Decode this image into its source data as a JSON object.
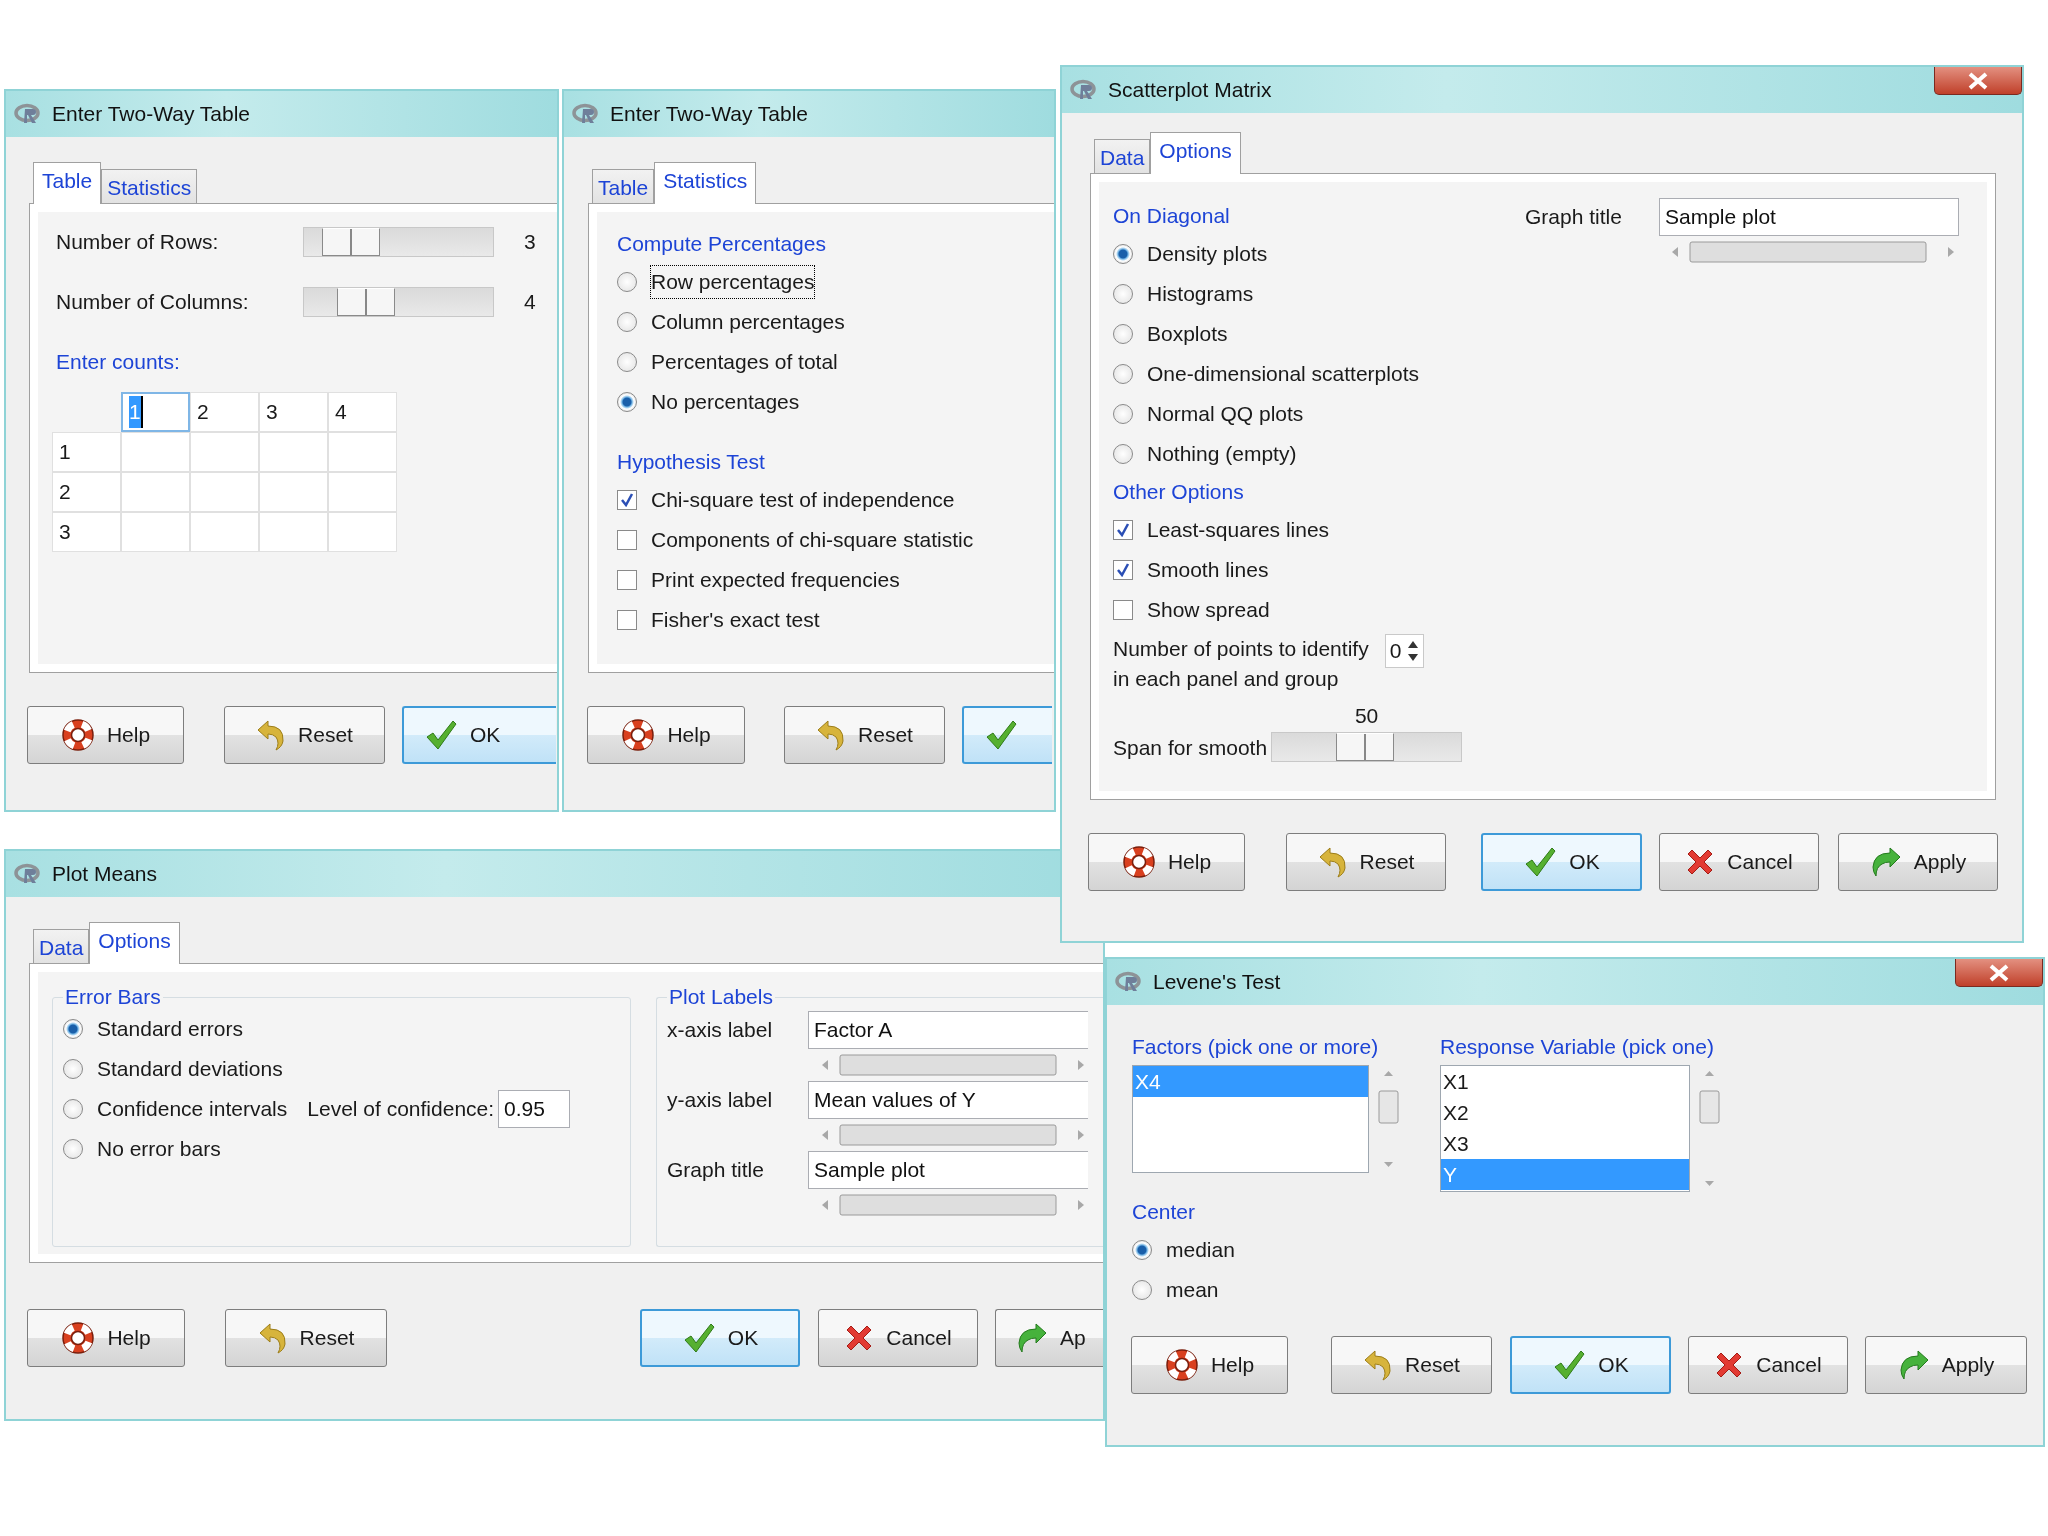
{
  "windows": [
    {
      "kind": "two_way_table",
      "title": "Enter Two-Way Table",
      "tabs": [
        {
          "label": "Table",
          "selected": true
        },
        {
          "label": "Statistics",
          "selected": false
        }
      ],
      "sliders": [
        {
          "label": "Number of Rows:",
          "level": 0.14,
          "reading": "3"
        },
        {
          "label": "Number of Columns:",
          "level": 0.25,
          "reading": "4"
        }
      ],
      "counts_heading": "Enter counts:",
      "column_headers": [
        {
          "text": "1",
          "selected": true
        },
        {
          "text": "2",
          "selected": false
        },
        {
          "text": "3",
          "selected": false
        },
        {
          "text": "4",
          "selected": false
        }
      ],
      "row_headers": [
        "1",
        "2",
        "3"
      ],
      "buttons": [
        {
          "kind": "help",
          "label": "Help",
          "default": false
        },
        {
          "kind": "reset",
          "label": "Reset",
          "default": false
        },
        {
          "kind": "ok",
          "label": "OK",
          "default": true
        }
      ]
    },
    {
      "kind": "two_way_statistics",
      "title": "Enter Two-Way Table",
      "tabs": [
        {
          "label": "Table",
          "selected": false
        },
        {
          "label": "Statistics",
          "selected": true
        }
      ],
      "groups": [
        {
          "heading": "Compute Percentages",
          "options": [
            {
              "kind": "radio",
              "label": "Row percentages",
              "checked": false,
              "focused": true
            },
            {
              "kind": "radio",
              "label": "Column percentages",
              "checked": false
            },
            {
              "kind": "radio",
              "label": "Percentages of total",
              "checked": false
            },
            {
              "kind": "radio",
              "label": "No percentages",
              "checked": true
            }
          ]
        },
        {
          "heading": "Hypothesis Test",
          "options": [
            {
              "kind": "checkbox",
              "label": "Chi-square test of independence",
              "checked": true
            },
            {
              "kind": "checkbox",
              "label": "Components of chi-square statistic",
              "checked": false
            },
            {
              "kind": "checkbox",
              "label": "Print expected frequencies",
              "checked": false
            },
            {
              "kind": "checkbox",
              "label": "Fisher's exact test",
              "checked": false
            }
          ]
        }
      ],
      "buttons": [
        {
          "kind": "help",
          "label": "Help",
          "default": false
        },
        {
          "kind": "reset",
          "label": "Reset",
          "default": false
        },
        {
          "kind": "ok",
          "default": true
        }
      ]
    },
    {
      "kind": "scatterplot_options",
      "title": "Scatterplot Matrix",
      "close_button": true,
      "tabs": [
        {
          "label": "Data",
          "selected": false
        },
        {
          "label": "Options",
          "selected": true
        }
      ],
      "groups": [
        {
          "heading": "On Diagonal",
          "options": [
            {
              "kind": "radio",
              "label": "Density plots",
              "checked": true
            },
            {
              "kind": "radio",
              "label": "Histograms",
              "checked": false
            },
            {
              "kind": "radio",
              "label": "Boxplots",
              "checked": false
            },
            {
              "kind": "radio",
              "label": "One-dimensional scatterplots",
              "checked": false
            },
            {
              "kind": "radio",
              "label": "Normal QQ plots",
              "checked": false
            },
            {
              "kind": "radio",
              "label": "Nothing (empty)",
              "checked": false
            }
          ]
        },
        {
          "heading": "Other Options",
          "options": [
            {
              "kind": "checkbox",
              "label": "Least-squares lines",
              "checked": true
            },
            {
              "kind": "checkbox",
              "label": "Smooth lines",
              "checked": true
            },
            {
              "kind": "checkbox",
              "label": "Show spread",
              "checked": false
            }
          ]
        }
      ],
      "points": {
        "lines": [
          "Number of points to identify",
          "in each panel and group"
        ],
        "value": "0"
      },
      "span": {
        "label": "Span for smooth",
        "reading": "50",
        "level": 0.49
      },
      "graph_title": {
        "label": "Graph title",
        "value": "Sample plot"
      },
      "buttons": [
        {
          "kind": "help",
          "label": "Help",
          "default": false
        },
        {
          "kind": "reset",
          "label": "Reset",
          "default": false
        },
        {
          "kind": "ok",
          "label": "OK",
          "default": true
        },
        {
          "kind": "cancel",
          "label": "Cancel",
          "default": false
        },
        {
          "kind": "apply",
          "label": "Apply",
          "default": false
        }
      ]
    },
    {
      "kind": "plot_means_options",
      "title": "Plot Means",
      "tabs": [
        {
          "label": "Data",
          "selected": false
        },
        {
          "label": "Options",
          "selected": true
        }
      ],
      "error_bars": {
        "heading": "Error Bars",
        "options": [
          {
            "kind": "radio",
            "label": "Standard errors",
            "checked": true
          },
          {
            "kind": "radio",
            "label": "Standard deviations",
            "checked": false
          },
          {
            "kind": "radio",
            "label": "Confidence intervals",
            "checked": false,
            "field": {
              "label": "Level of confidence:",
              "value": "0.95"
            }
          },
          {
            "kind": "radio",
            "label": "No error bars",
            "checked": false
          }
        ]
      },
      "plot_labels": {
        "heading": "Plot Labels",
        "fields": [
          {
            "label": "x-axis label",
            "value": "Factor A"
          },
          {
            "label": "y-axis label",
            "value": "Mean values of Y"
          },
          {
            "label": "Graph title",
            "value": "Sample plot"
          }
        ]
      },
      "buttons": [
        {
          "kind": "help",
          "label": "Help",
          "default": false
        },
        {
          "kind": "reset",
          "label": "Reset",
          "default": false
        },
        {
          "kind": "ok",
          "label": "OK",
          "default": true
        },
        {
          "kind": "cancel",
          "label": "Cancel",
          "default": false
        },
        {
          "kind": "apply",
          "label": "Ap",
          "default": false
        }
      ]
    },
    {
      "kind": "levene",
      "title": "Levene's Test",
      "close_button": true,
      "factors": {
        "heading": "Factors (pick one or more)",
        "items": [
          {
            "text": "X4",
            "selected": true
          }
        ]
      },
      "response": {
        "heading": "Response Variable (pick one)",
        "items": [
          {
            "text": "X1",
            "selected": false
          },
          {
            "text": "X2",
            "selected": false
          },
          {
            "text": "X3",
            "selected": false
          },
          {
            "text": "Y",
            "selected": true
          }
        ]
      },
      "center": {
        "heading": "Center",
        "options": [
          {
            "kind": "radio",
            "label": "median",
            "checked": true
          },
          {
            "kind": "radio",
            "label": "mean",
            "checked": false
          }
        ]
      },
      "buttons": [
        {
          "kind": "help",
          "label": "Help",
          "default": false
        },
        {
          "kind": "reset",
          "label": "Reset",
          "default": false
        },
        {
          "kind": "ok",
          "label": "OK",
          "default": true
        },
        {
          "kind": "cancel",
          "label": "Cancel",
          "default": false
        },
        {
          "kind": "apply",
          "label": "Apply",
          "default": false
        }
      ]
    }
  ]
}
